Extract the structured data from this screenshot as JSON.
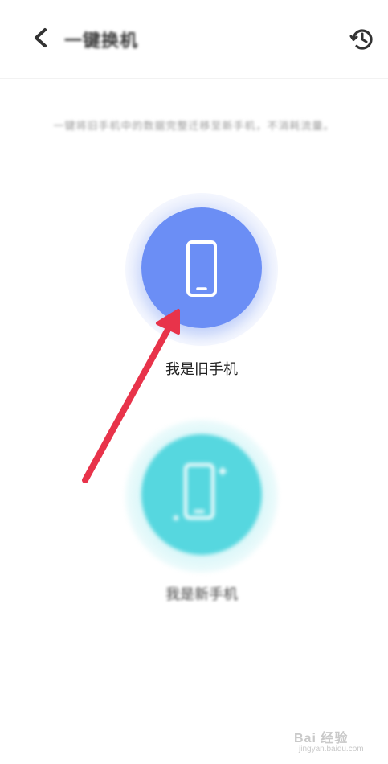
{
  "header": {
    "title": "一键换机",
    "back_icon": "chevron-left-icon",
    "history_icon": "history-clock-icon"
  },
  "description": "一键将旧手机中的数据完整迁移至新手机，不消耗流量。",
  "options": {
    "old_phone": {
      "label": "我是旧手机",
      "icon": "phone-icon",
      "color": "#6b8ef5"
    },
    "new_phone": {
      "label": "我是新手机",
      "icon": "phone-transfer-icon",
      "color": "#56d7df"
    }
  },
  "annotation": {
    "color": "#e8334a"
  },
  "watermark": {
    "brand": "Bai 经验",
    "url": "jingyan.baidu.com"
  }
}
